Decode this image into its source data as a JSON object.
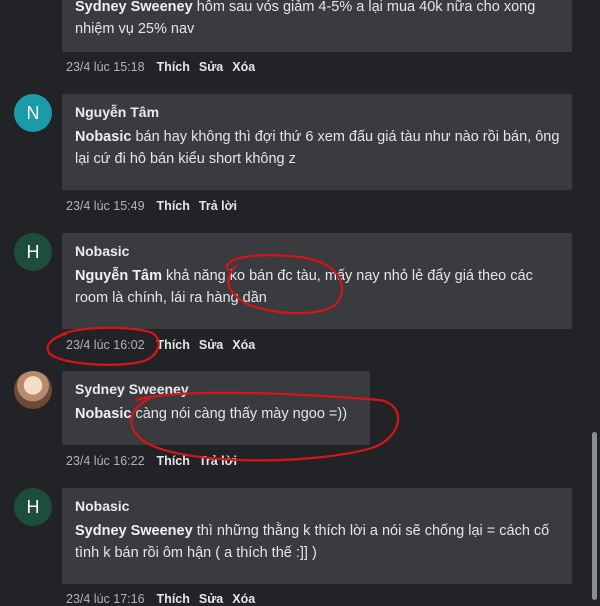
{
  "comments": [
    {
      "author": "Sydney Sweeney",
      "mention": "",
      "text": "hôm sau vós giảm 4-5% a lại mua 40k nữa cho xong nhiệm vụ 25% nav",
      "time": "23/4 lúc 15:18",
      "actions": [
        "Thích",
        "Sửa",
        "Xóa"
      ]
    },
    {
      "avatar": "N",
      "avatar_color": "#1a9ba8",
      "author": "Nguyễn Tâm",
      "mention": "Nobasic",
      "text": "bán hay không thì đợi thứ 6 xem đấu giá tàu như nào rồi bán, ông lại cứ đi hô bán kiểu short không z",
      "time": "23/4 lúc 15:49",
      "actions": [
        "Thích",
        "Trả lời"
      ]
    },
    {
      "avatar": "H",
      "avatar_color": "#1d4e3b",
      "author": "Nobasic",
      "mention": "Nguyễn Tâm",
      "text": "khả năng ko bán đc tàu, mấy nay nhỏ lẻ đẩy giá theo các room là chính, lái ra hàng dần",
      "time": "23/4 lúc 16:02",
      "actions": [
        "Thích",
        "Sửa",
        "Xóa"
      ]
    },
    {
      "avatar_icon": "profile-photo-avatar",
      "author": "Sydney Sweeney",
      "mention": "Nobasic",
      "text": "càng nói càng thấy mày ngoo =))",
      "time": "23/4 lúc 16:22",
      "actions": [
        "Thích",
        "Trả lời"
      ]
    },
    {
      "avatar": "H",
      "avatar_color": "#1d4e3b",
      "author": "Nobasic",
      "mention": "Sydney Sweeney",
      "text": "thì những thằng k thích lời a nói sẽ chống lại = cách cố tình k bán rồi ôm hận ( a thích thế :]] )",
      "time": "23/4 lúc 17:16",
      "actions": [
        "Thích",
        "Sửa",
        "Xóa"
      ]
    }
  ],
  "colors": {
    "background": "#212326",
    "bubble": "#3a3b3e",
    "annotation": "#d8141a"
  }
}
